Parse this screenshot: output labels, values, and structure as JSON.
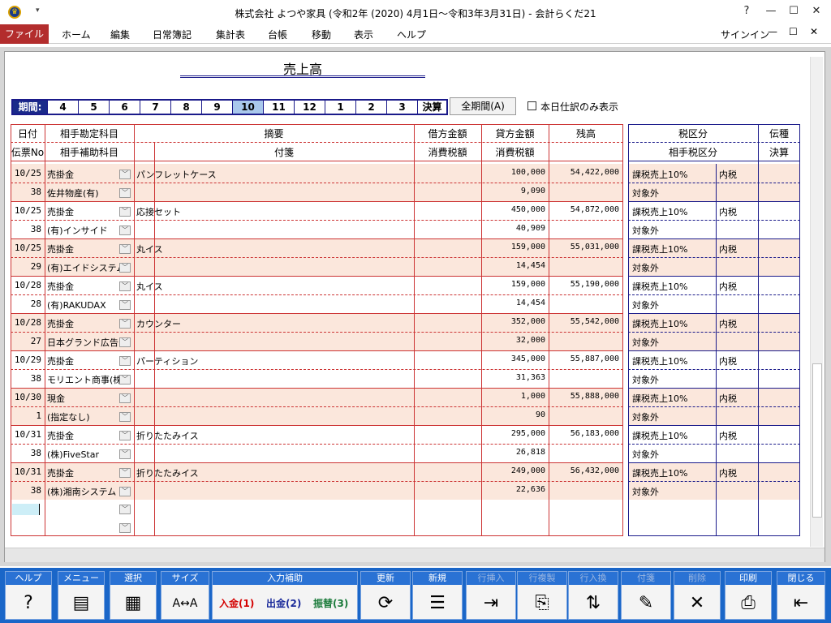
{
  "window": {
    "title": "株式会社 よつや家具 (令和2年 (2020) 4月1日～令和3年3月31日) - 会計らくだ21",
    "help": "?",
    "minimize": "—",
    "maximize": "☐",
    "close": "✕",
    "qa": "▾"
  },
  "menu": {
    "file": "ファイル",
    "items": [
      "ホーム",
      "編集",
      "日常簿記",
      "集計表",
      "台帳",
      "移動",
      "表示",
      "ヘルプ"
    ],
    "signin": "サインイン"
  },
  "report": {
    "title": "売上高"
  },
  "period": {
    "label": "期間:",
    "months": [
      "4",
      "5",
      "6",
      "7",
      "8",
      "9",
      "10",
      "11",
      "12",
      "1",
      "2",
      "3"
    ],
    "selected": "10",
    "closing": "決算",
    "all_button": "全期間(A)",
    "checkbox_label": "本日仕訳のみ表示"
  },
  "headers": {
    "date": "日付",
    "slip": "伝票No",
    "account": "相手勘定科目",
    "subaccount": "相手補助科目",
    "summary": "摘要",
    "note": "付箋",
    "debit": "借方金額",
    "debit_tax": "消費税額",
    "credit": "貸方金額",
    "credit_tax": "消費税額",
    "balance": "残高",
    "tax_class": "税区分",
    "partner_tax": "相手税区分",
    "voucher": "伝種",
    "closing": "決算"
  },
  "rows": [
    {
      "date": "10/25",
      "slip": "38",
      "account": "売掛金",
      "sub": "佐井物産(有)",
      "summary": "パンフレットケース",
      "credit": "100,000",
      "tax": "9,090",
      "balance": "54,422,000",
      "taxclass": "課税売上10%",
      "inc": "内税",
      "partner": "対象外"
    },
    {
      "date": "10/25",
      "slip": "38",
      "account": "売掛金",
      "sub": "(有)インサイド",
      "summary": "応接セット",
      "credit": "450,000",
      "tax": "40,909",
      "balance": "54,872,000",
      "taxclass": "課税売上10%",
      "inc": "内税",
      "partner": "対象外"
    },
    {
      "date": "10/25",
      "slip": "29",
      "account": "売掛金",
      "sub": "(有)エイドシステム",
      "summary": "丸イス",
      "credit": "159,000",
      "tax": "14,454",
      "balance": "55,031,000",
      "taxclass": "課税売上10%",
      "inc": "内税",
      "partner": "対象外"
    },
    {
      "date": "10/28",
      "slip": "28",
      "account": "売掛金",
      "sub": "(有)RAKUDAX",
      "summary": "丸イス",
      "credit": "159,000",
      "tax": "14,454",
      "balance": "55,190,000",
      "taxclass": "課税売上10%",
      "inc": "内税",
      "partner": "対象外"
    },
    {
      "date": "10/28",
      "slip": "27",
      "account": "売掛金",
      "sub": "日本グランド広告",
      "summary": "カウンター",
      "credit": "352,000",
      "tax": "32,000",
      "balance": "55,542,000",
      "taxclass": "課税売上10%",
      "inc": "内税",
      "partner": "対象外"
    },
    {
      "date": "10/29",
      "slip": "38",
      "account": "売掛金",
      "sub": "モリエント商事(株)",
      "summary": "パーティション",
      "credit": "345,000",
      "tax": "31,363",
      "balance": "55,887,000",
      "taxclass": "課税売上10%",
      "inc": "内税",
      "partner": "対象外"
    },
    {
      "date": "10/30",
      "slip": "1",
      "account": "現金",
      "sub": "(指定なし)",
      "summary": "",
      "credit": "1,000",
      "tax": "90",
      "balance": "55,888,000",
      "taxclass": "課税売上10%",
      "inc": "内税",
      "partner": "対象外"
    },
    {
      "date": "10/31",
      "slip": "38",
      "account": "売掛金",
      "sub": "(株)FiveStar",
      "summary": "折りたたみイス",
      "credit": "295,000",
      "tax": "26,818",
      "balance": "56,183,000",
      "taxclass": "課税売上10%",
      "inc": "内税",
      "partner": "対象外"
    },
    {
      "date": "10/31",
      "slip": "38",
      "account": "売掛金",
      "sub": "(株)湘南システム",
      "summary": "折りたたみイス",
      "credit": "249,000",
      "tax": "22,636",
      "balance": "56,432,000",
      "taxclass": "課税売上10%",
      "inc": "内税",
      "partner": "対象外"
    }
  ],
  "toolbar": [
    {
      "label": "ヘルプ",
      "icon": "?",
      "name": "help"
    },
    {
      "label": "メニュー",
      "icon": "▤",
      "name": "menu"
    },
    {
      "label": "選択",
      "icon": "▦",
      "name": "select"
    },
    {
      "label": "サイズ",
      "icon": "A↔A",
      "name": "size"
    },
    {
      "label": "更新",
      "icon": "⟳",
      "name": "refresh"
    },
    {
      "label": "新規",
      "icon": "☰",
      "name": "new"
    },
    {
      "label": "行挿入",
      "icon": "⇥",
      "name": "insert-row"
    },
    {
      "label": "行複製",
      "icon": "⎘",
      "name": "duplicate-row"
    },
    {
      "label": "行入換",
      "icon": "⇅",
      "name": "swap-row"
    },
    {
      "label": "付箋",
      "icon": "✎",
      "name": "sticky"
    },
    {
      "label": "削除",
      "icon": "✕",
      "name": "delete"
    },
    {
      "label": "印刷",
      "icon": "⎙",
      "name": "print"
    },
    {
      "label": "閉じる",
      "icon": "⇤",
      "name": "close"
    }
  ],
  "input_assist": {
    "label": "入力補助",
    "in": "入金(1)",
    "out": "出金(2)",
    "transfer": "振替(3)"
  }
}
